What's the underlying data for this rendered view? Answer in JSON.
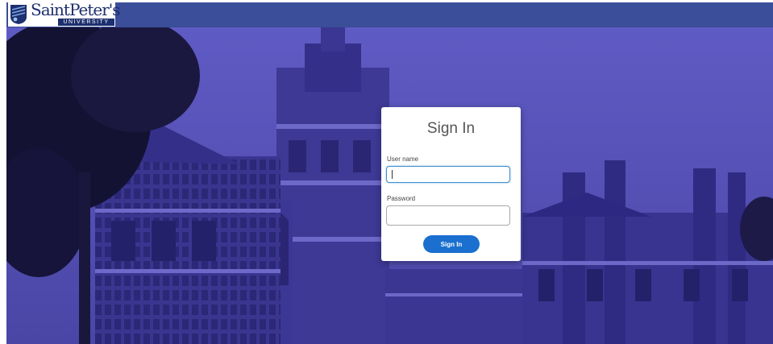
{
  "header": {
    "logo": {
      "name": "SaintPeter's",
      "subtitle": "UNIVERSITY",
      "icon": "university-crest-icon"
    }
  },
  "login": {
    "title": "Sign In",
    "username_label": "User name",
    "username_value": "",
    "password_label": "Password",
    "password_value": "",
    "submit_label": "Sign In"
  },
  "colors": {
    "topbar": "#3a4e99",
    "overlay": "#5753b8",
    "button": "#1a6fcf",
    "brand": "#1c2f6e"
  }
}
